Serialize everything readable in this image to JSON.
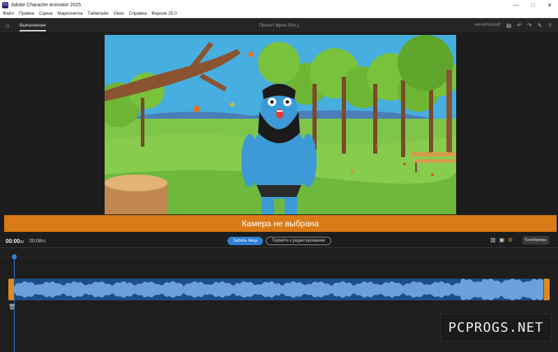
{
  "window": {
    "title": "Adobe Character Animator 2025",
    "app_icon_text": "Ch"
  },
  "menu": [
    "Файл",
    "Правка",
    "Сцена",
    "Марионетка",
    "Таймлайн",
    "Окно",
    "Справка",
    "Версия 25.0"
  ],
  "workspace": {
    "tab": "Выполнение",
    "project_title": "Проект Фрон (без.)",
    "start_label": "НАЧАЛЬНЫЙ"
  },
  "banner": {
    "text": "Камера не выбрана"
  },
  "transport": {
    "current_time": "00:00",
    "current_frames": "00",
    "total_time": "00:08",
    "total_frames": "53",
    "record_face_button": "Запись лица",
    "go_edit_button": "Перейти к редактированию",
    "calibrate_label": "Калибровка"
  },
  "watermark": "PCPROGS.NET",
  "colors": {
    "accent_orange": "#d97a16",
    "accent_blue": "#2f7fd6",
    "waveform_bg": "#1e4e8a",
    "waveform": "#6b9fde"
  },
  "icons": [
    "home-icon",
    "layout-icon",
    "undo-icon",
    "redo-icon",
    "comment-icon",
    "share-icon",
    "trash-icon",
    "gear-icon"
  ]
}
